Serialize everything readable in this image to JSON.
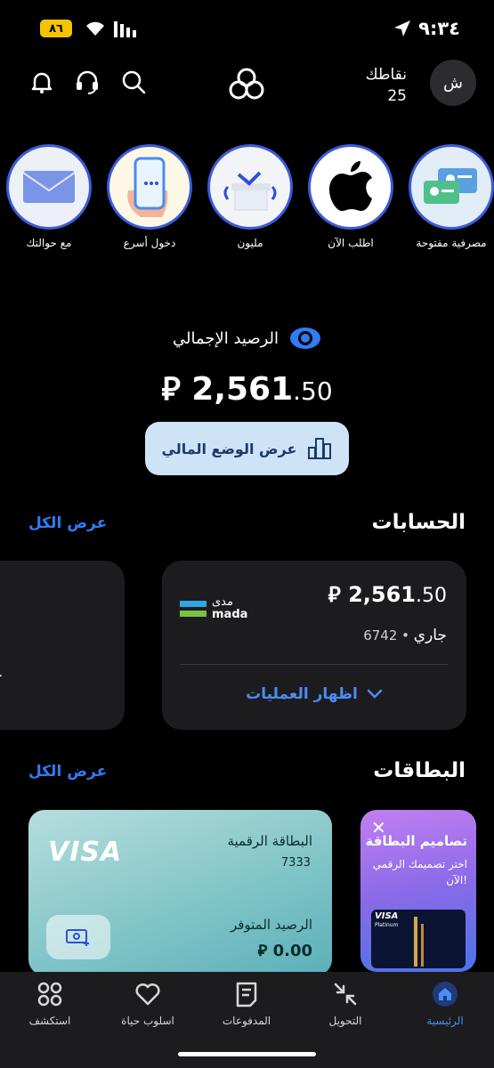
{
  "status_bar": {
    "time": "٩:٣٤",
    "battery": "٨٦"
  },
  "header": {
    "avatar_initial": "ش",
    "points_label": "نقاطك",
    "points_value": "25"
  },
  "stories": [
    {
      "label": "مصرفية مفتوحة"
    },
    {
      "label": "اطلب الآن"
    },
    {
      "label": "مليون"
    },
    {
      "label": "دخول أسرع"
    },
    {
      "label": "مع حوالتك"
    }
  ],
  "balance": {
    "title": "الرصيد الإجمالي",
    "amount_main": "2,561",
    "amount_decimal": ".50",
    "currency": "⃁"
  },
  "financial_button": {
    "label": "عرض الوضع المالي"
  },
  "accounts": {
    "title": "الحسابات",
    "view_all": "عرض الكل",
    "card": {
      "amount_main": "2,561",
      "amount_decimal": ".50",
      "type": "جاري",
      "number": "6742",
      "mada_ar": "مدى",
      "mada_en": "mada",
      "toggle": "اظهار العمليات"
    },
    "peek_text": "ح"
  },
  "cards": {
    "title": "البطاقات",
    "view_all": "عرض الكل",
    "promo": {
      "title": "تصاميم البطاقة",
      "subtitle": "اختر تصميمك الرقمي الآن!",
      "mini_visa": "VISA",
      "mini_platinum": "Platinum"
    },
    "visa": {
      "brand": "VISA",
      "name": "البطاقة الرقمية",
      "number": "7333",
      "available_label": "الرصيد المتوفر",
      "available_value": "0.00"
    }
  },
  "bottom_nav": [
    {
      "label": "الرئيسية",
      "icon": "home-icon",
      "active": true
    },
    {
      "label": "التحويل",
      "icon": "transfer-icon"
    },
    {
      "label": "المدفوعات",
      "icon": "payments-icon"
    },
    {
      "label": "اسلوب حياة",
      "icon": "heart-icon"
    },
    {
      "label": "استكشف",
      "icon": "explore-icon"
    }
  ],
  "colors": {
    "accent": "#2e7cf6",
    "card_bg": "#1c1c1e",
    "story_ring": "#3b5bdb"
  }
}
